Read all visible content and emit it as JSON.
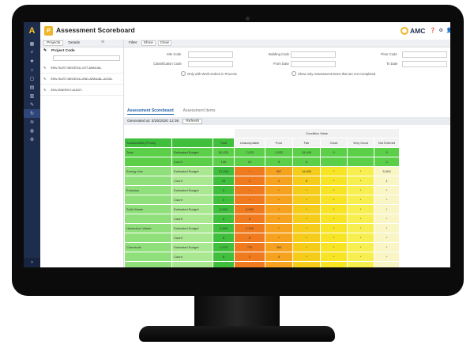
{
  "app": {
    "title": "Assessment Scoreboard",
    "icon_letter": "P",
    "brand": "AMC",
    "header_icons": [
      "help-icon",
      "settings-icon",
      "user-icon",
      "minimize-icon"
    ]
  },
  "nav": {
    "icons": [
      "grid-icon",
      "search-icon",
      "star-icon",
      "house-icon",
      "box-icon",
      "clipboard-icon",
      "document-icon",
      "wrench-icon",
      "refresh-icon",
      "layers-icon",
      "bulb-icon",
      "gear-icon"
    ],
    "active_index": 8,
    "expand_glyph": "›"
  },
  "left_panel": {
    "tabs": [
      "Projects",
      "Details"
    ],
    "column_header": "Project Code",
    "projects": [
      "ENV-SUST-NEGEDU-1ST-ANNUAL",
      "ENV-SUST-NEGEDU-2ND-ANNUAL-ACIDL",
      "ENV-ENERGY-AUDIT-"
    ]
  },
  "filter": {
    "tabs": [
      "Filter",
      "Show",
      "Clear"
    ],
    "fields": {
      "site_code": "Site Code",
      "classification_code": "Classification Code",
      "building_code": "Building Code",
      "from_date": "From Date",
      "floor_code": "Floor Code",
      "to_date": "To Date"
    },
    "work_orders_option": "Only with Work Orders in Process",
    "incomplete_option": "Show only Assessment Items that are not Completed"
  },
  "subtabs": [
    "Assessment Scoreboard",
    "Assessment Items"
  ],
  "generated_label": "Generated at: 3/26/2020 12:36",
  "refresh_label": "Refresh",
  "table": {
    "group_header": "Condition Value",
    "headers": [
      "Sustainability Priority",
      "",
      "Total",
      "Unacceptable",
      "Poor",
      "Fair",
      "Good",
      "Very Good",
      "Not Entered"
    ],
    "rows": [
      {
        "group": "Total",
        "metric": "Estimated Budget",
        "total": "50,025",
        "cells": [
          "7,023",
          "1,532",
          "15,400",
          "0",
          "",
          "0"
        ]
      },
      {
        "group": "",
        "metric": "Count",
        "total": "136",
        "cells": [
          "14",
          "5",
          "8",
          "",
          "",
          "0"
        ]
      },
      {
        "group": "Energy Use",
        "metric": "Estimated Budget",
        "total": "21,028",
        "cells": [
          "*",
          "957",
          "14,600",
          "*",
          "*",
          "5,000"
        ]
      },
      {
        "group": "",
        "metric": "Count",
        "total": "19",
        "cells": [
          "1",
          "1",
          "5",
          "*",
          "*",
          "1"
        ]
      },
      {
        "group": "Emission",
        "metric": "Estimated Budget",
        "total": "0",
        "cells": [
          "*",
          "*",
          "*",
          "*",
          "*",
          "*"
        ]
      },
      {
        "group": "",
        "metric": "Count",
        "total": "0",
        "cells": [
          "*",
          "*",
          "*",
          "*",
          "*",
          "*"
        ]
      },
      {
        "group": "Solid Waste",
        "metric": "Estimated Budget",
        "total": "3,000",
        "cells": [
          "3,000",
          "*",
          "*",
          "*",
          "*",
          "*"
        ]
      },
      {
        "group": "",
        "metric": "Count",
        "total": "6",
        "cells": [
          "6",
          "*",
          "*",
          "*",
          "*",
          "*"
        ]
      },
      {
        "group": "Hazardous Waste",
        "metric": "Estimated Budget",
        "total": "2,450",
        "cells": [
          "2,450",
          "*",
          "*",
          "*",
          "*",
          "*"
        ]
      },
      {
        "group": "",
        "metric": "Count",
        "total": "8",
        "cells": [
          "8",
          "*",
          "*",
          "*",
          "*",
          "*"
        ]
      },
      {
        "group": "Chemicals",
        "metric": "Estimated Budget",
        "total": "1,075",
        "cells": [
          "775",
          "300",
          "*",
          "*",
          "*",
          "*"
        ]
      },
      {
        "group": "",
        "metric": "Count",
        "total": "6",
        "cells": [
          "2",
          "4",
          "*",
          "*",
          "*",
          "*"
        ]
      },
      {
        "group": "",
        "metric": "",
        "total": "",
        "cells": [
          "",
          "",
          "",
          "",
          "",
          ""
        ]
      }
    ]
  },
  "colors": {
    "nav_bg": "#1f2d4c",
    "brand_yellow": "#f0b62a",
    "header_green": "#3fbf3c",
    "total_row": "#5ccf49",
    "group_bg": "#8fe07a",
    "metric_bg": "#a9e890",
    "unacceptable": "#f07a1e",
    "poor": "#f6a21f",
    "fair": "#f6cc1a",
    "good": "#f7e425",
    "very_good": "#f7ee4f",
    "not_entered": "#f9f5c4"
  }
}
